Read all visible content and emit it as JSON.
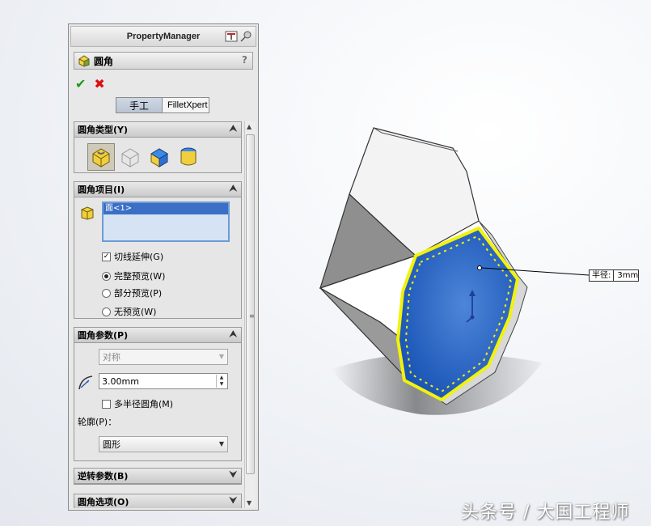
{
  "panel": {
    "title": "PropertyManager",
    "feature_name": "圆角",
    "help": "?",
    "ok_symbol": "✔",
    "cancel_symbol": "✖",
    "tabs": [
      {
        "label": "手工",
        "active": true
      },
      {
        "label": "FilletXpert",
        "active": false
      }
    ]
  },
  "fillet_type": {
    "header": "圆角类型(Y)",
    "chevron": "⮝",
    "options": [
      {
        "icon": "constant-radius-fillet-icon",
        "selected": true
      },
      {
        "icon": "variable-radius-fillet-icon",
        "selected": false
      },
      {
        "icon": "face-fillet-icon",
        "selected": false
      },
      {
        "icon": "full-round-fillet-icon",
        "selected": false
      }
    ]
  },
  "fillet_items": {
    "header": "圆角项目(I)",
    "chevron": "⮝",
    "selection": [
      "面<1>"
    ],
    "tangent_propagation": {
      "label": "切线延伸(G)",
      "checked": true
    },
    "preview_options": [
      {
        "label": "完整预览(W)",
        "selected": true
      },
      {
        "label": "部分预览(P)",
        "selected": false
      },
      {
        "label": "无预览(W)",
        "selected": false
      }
    ]
  },
  "fillet_params": {
    "header": "圆角参数(P)",
    "chevron": "⮝",
    "symmetry": "对称",
    "radius_value": "3.00mm",
    "multi_radius": {
      "label": "多半径圆角(M)",
      "checked": false
    },
    "profile_label": "轮廓(P)：",
    "profile_value": "圆形"
  },
  "setback": {
    "header": "逆转参数(B)",
    "chevron": "⮟"
  },
  "fillet_options": {
    "header": "圆角选项(O)",
    "chevron": "⮟"
  },
  "callout": {
    "key": "半径:",
    "value": "3mm"
  },
  "watermark": "头条号 / 大国工程师",
  "colors": {
    "face_blue": "#1e5fc8",
    "edge_yellow": "#f2f20a",
    "accent": "#3b6fc6"
  }
}
